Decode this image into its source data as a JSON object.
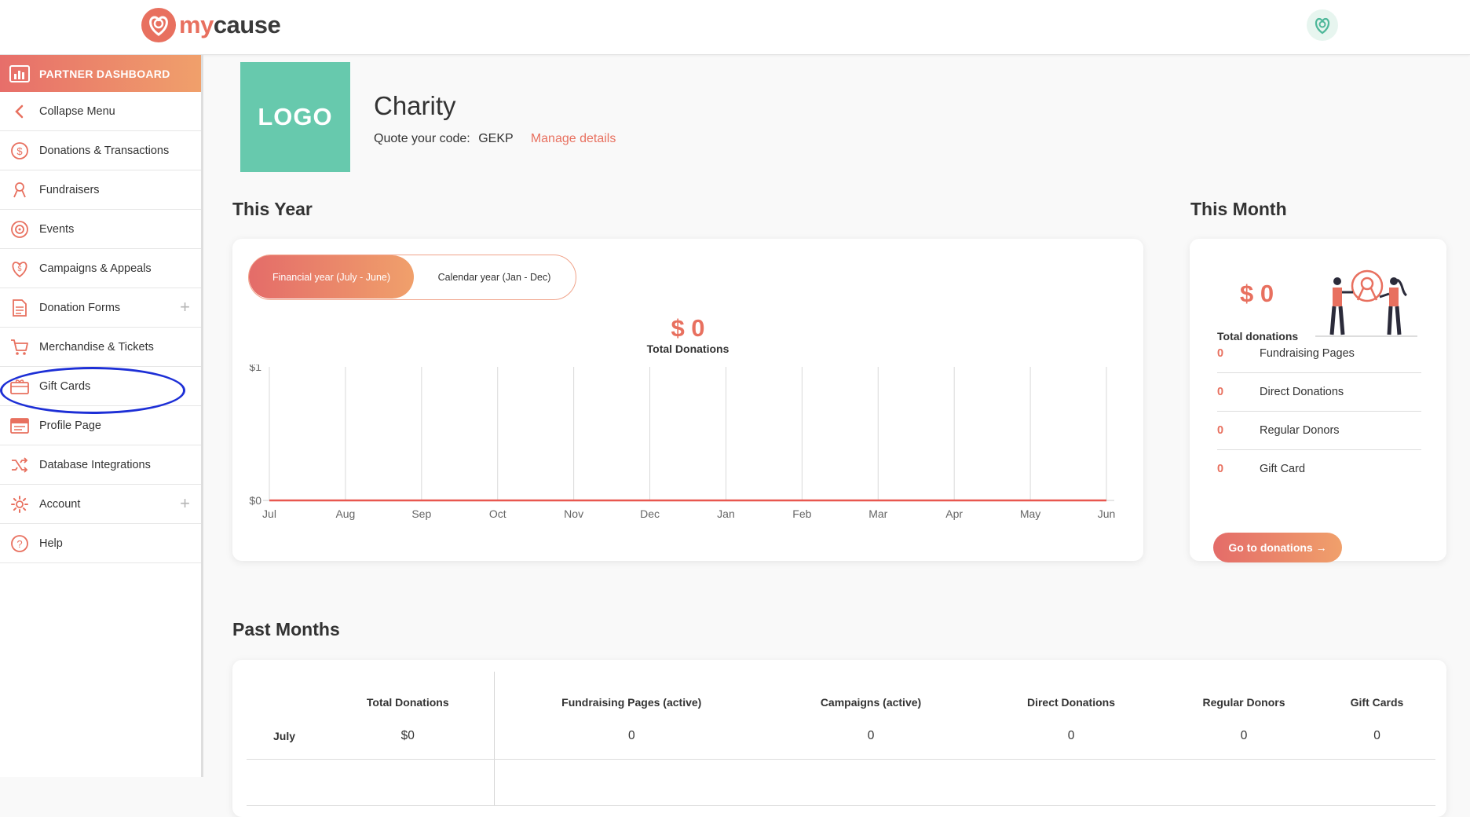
{
  "brand": {
    "name_part1": "my",
    "name_part2": "cause",
    "icon": "mycause-heart-logo-icon"
  },
  "header": {
    "avatar_icon": "user-avatar-icon"
  },
  "sidebar": {
    "header": {
      "label": "PARTNER DASHBOARD",
      "icon": "bar-chart-icon"
    },
    "items": [
      {
        "label": "Collapse Menu",
        "icon": "chevron-left-icon",
        "expandable": false
      },
      {
        "label": "Donations & Transactions",
        "icon": "dollar-circle-icon",
        "expandable": false
      },
      {
        "label": "Fundraisers",
        "icon": "ribbon-icon",
        "expandable": false
      },
      {
        "label": "Events",
        "icon": "target-icon",
        "expandable": false
      },
      {
        "label": "Campaigns & Appeals",
        "icon": "heart-dollar-icon",
        "expandable": false
      },
      {
        "label": "Donation Forms",
        "icon": "form-icon",
        "expandable": true
      },
      {
        "label": "Merchandise & Tickets",
        "icon": "cart-icon",
        "expandable": false
      },
      {
        "label": "Gift Cards",
        "icon": "gift-card-icon",
        "expandable": false
      },
      {
        "label": "Profile Page",
        "icon": "profile-page-icon",
        "expandable": false
      },
      {
        "label": "Database Integrations",
        "icon": "shuffle-icon",
        "expandable": false
      },
      {
        "label": "Account",
        "icon": "gear-icon",
        "expandable": true
      },
      {
        "label": "Help",
        "icon": "question-icon",
        "expandable": false
      }
    ],
    "plus_symbol": "+"
  },
  "charity": {
    "logo_text": "LOGO",
    "name": "Charity",
    "quote_label": "Quote your code:",
    "code": "GEKP",
    "manage_link": "Manage details"
  },
  "this_year": {
    "title": "This Year",
    "toggle": {
      "financial": "Financial year (July - June)",
      "calendar": "Calendar year (Jan - Dec)",
      "selected": "financial"
    },
    "total_amount": "$ 0",
    "total_label": "Total Donations"
  },
  "chart_data": {
    "type": "line",
    "categories": [
      "Jul",
      "Aug",
      "Sep",
      "Oct",
      "Nov",
      "Dec",
      "Jan",
      "Feb",
      "Mar",
      "Apr",
      "May",
      "Jun"
    ],
    "series": [
      {
        "values": [
          0,
          0,
          0,
          0,
          0,
          0,
          0,
          0,
          0,
          0,
          0,
          0
        ]
      }
    ],
    "y_ticks": [
      "$0",
      "$1"
    ],
    "ylim": [
      0,
      1
    ],
    "grid": "vertical",
    "line_color": "#e8574f"
  },
  "this_month": {
    "title": "This Month",
    "amount": "$ 0",
    "label": "Total donations",
    "illustration": "people-holding-ribbon-illustration",
    "rows": [
      {
        "value": "0",
        "label": "Fundraising Pages"
      },
      {
        "value": "0",
        "label": "Direct Donations"
      },
      {
        "value": "0",
        "label": "Regular Donors"
      },
      {
        "value": "0",
        "label": "Gift Card"
      }
    ],
    "button": "Go to donations →"
  },
  "past_months": {
    "title": "Past Months",
    "columns": [
      "",
      "Total Donations",
      "Fundraising Pages (active)",
      "Campaigns (active)",
      "Direct Donations",
      "Regular Donors",
      "Gift Cards"
    ],
    "rows": [
      {
        "month": "July",
        "total": "$0",
        "pages": "0",
        "campaigns": "0",
        "direct": "0",
        "regular": "0",
        "gift": "0"
      }
    ]
  },
  "colors": {
    "accent": "#e8705f",
    "gradient_start": "#e46c69",
    "gradient_end": "#f0a06b",
    "logo_bg": "#67c9ad",
    "annotation": "#1d2fd6"
  }
}
